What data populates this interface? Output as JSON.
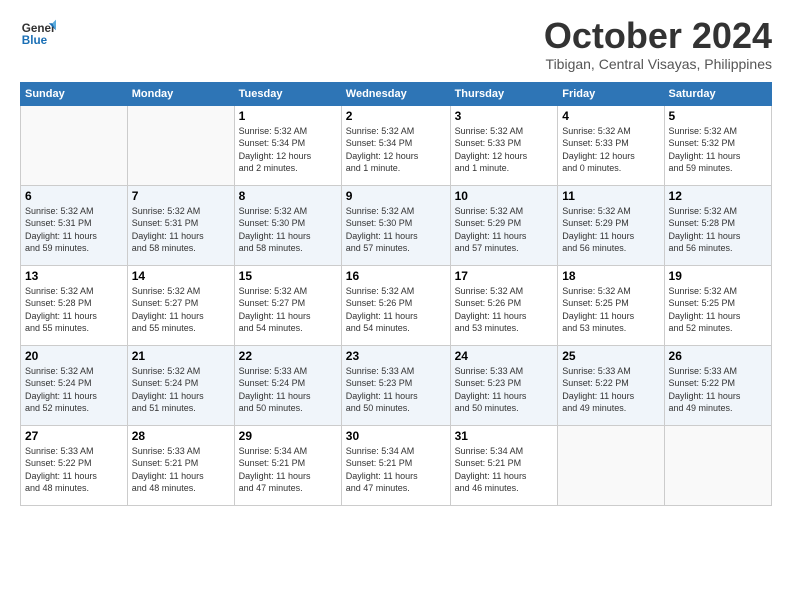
{
  "header": {
    "logo_line1": "General",
    "logo_line2": "Blue",
    "month": "October 2024",
    "location": "Tibigan, Central Visayas, Philippines"
  },
  "columns": [
    "Sunday",
    "Monday",
    "Tuesday",
    "Wednesday",
    "Thursday",
    "Friday",
    "Saturday"
  ],
  "rows": [
    [
      {
        "num": "",
        "info": ""
      },
      {
        "num": "",
        "info": ""
      },
      {
        "num": "1",
        "info": "Sunrise: 5:32 AM\nSunset: 5:34 PM\nDaylight: 12 hours\nand 2 minutes."
      },
      {
        "num": "2",
        "info": "Sunrise: 5:32 AM\nSunset: 5:34 PM\nDaylight: 12 hours\nand 1 minute."
      },
      {
        "num": "3",
        "info": "Sunrise: 5:32 AM\nSunset: 5:33 PM\nDaylight: 12 hours\nand 1 minute."
      },
      {
        "num": "4",
        "info": "Sunrise: 5:32 AM\nSunset: 5:33 PM\nDaylight: 12 hours\nand 0 minutes."
      },
      {
        "num": "5",
        "info": "Sunrise: 5:32 AM\nSunset: 5:32 PM\nDaylight: 11 hours\nand 59 minutes."
      }
    ],
    [
      {
        "num": "6",
        "info": "Sunrise: 5:32 AM\nSunset: 5:31 PM\nDaylight: 11 hours\nand 59 minutes."
      },
      {
        "num": "7",
        "info": "Sunrise: 5:32 AM\nSunset: 5:31 PM\nDaylight: 11 hours\nand 58 minutes."
      },
      {
        "num": "8",
        "info": "Sunrise: 5:32 AM\nSunset: 5:30 PM\nDaylight: 11 hours\nand 58 minutes."
      },
      {
        "num": "9",
        "info": "Sunrise: 5:32 AM\nSunset: 5:30 PM\nDaylight: 11 hours\nand 57 minutes."
      },
      {
        "num": "10",
        "info": "Sunrise: 5:32 AM\nSunset: 5:29 PM\nDaylight: 11 hours\nand 57 minutes."
      },
      {
        "num": "11",
        "info": "Sunrise: 5:32 AM\nSunset: 5:29 PM\nDaylight: 11 hours\nand 56 minutes."
      },
      {
        "num": "12",
        "info": "Sunrise: 5:32 AM\nSunset: 5:28 PM\nDaylight: 11 hours\nand 56 minutes."
      }
    ],
    [
      {
        "num": "13",
        "info": "Sunrise: 5:32 AM\nSunset: 5:28 PM\nDaylight: 11 hours\nand 55 minutes."
      },
      {
        "num": "14",
        "info": "Sunrise: 5:32 AM\nSunset: 5:27 PM\nDaylight: 11 hours\nand 55 minutes."
      },
      {
        "num": "15",
        "info": "Sunrise: 5:32 AM\nSunset: 5:27 PM\nDaylight: 11 hours\nand 54 minutes."
      },
      {
        "num": "16",
        "info": "Sunrise: 5:32 AM\nSunset: 5:26 PM\nDaylight: 11 hours\nand 54 minutes."
      },
      {
        "num": "17",
        "info": "Sunrise: 5:32 AM\nSunset: 5:26 PM\nDaylight: 11 hours\nand 53 minutes."
      },
      {
        "num": "18",
        "info": "Sunrise: 5:32 AM\nSunset: 5:25 PM\nDaylight: 11 hours\nand 53 minutes."
      },
      {
        "num": "19",
        "info": "Sunrise: 5:32 AM\nSunset: 5:25 PM\nDaylight: 11 hours\nand 52 minutes."
      }
    ],
    [
      {
        "num": "20",
        "info": "Sunrise: 5:32 AM\nSunset: 5:24 PM\nDaylight: 11 hours\nand 52 minutes."
      },
      {
        "num": "21",
        "info": "Sunrise: 5:32 AM\nSunset: 5:24 PM\nDaylight: 11 hours\nand 51 minutes."
      },
      {
        "num": "22",
        "info": "Sunrise: 5:33 AM\nSunset: 5:24 PM\nDaylight: 11 hours\nand 50 minutes."
      },
      {
        "num": "23",
        "info": "Sunrise: 5:33 AM\nSunset: 5:23 PM\nDaylight: 11 hours\nand 50 minutes."
      },
      {
        "num": "24",
        "info": "Sunrise: 5:33 AM\nSunset: 5:23 PM\nDaylight: 11 hours\nand 50 minutes."
      },
      {
        "num": "25",
        "info": "Sunrise: 5:33 AM\nSunset: 5:22 PM\nDaylight: 11 hours\nand 49 minutes."
      },
      {
        "num": "26",
        "info": "Sunrise: 5:33 AM\nSunset: 5:22 PM\nDaylight: 11 hours\nand 49 minutes."
      }
    ],
    [
      {
        "num": "27",
        "info": "Sunrise: 5:33 AM\nSunset: 5:22 PM\nDaylight: 11 hours\nand 48 minutes."
      },
      {
        "num": "28",
        "info": "Sunrise: 5:33 AM\nSunset: 5:21 PM\nDaylight: 11 hours\nand 48 minutes."
      },
      {
        "num": "29",
        "info": "Sunrise: 5:34 AM\nSunset: 5:21 PM\nDaylight: 11 hours\nand 47 minutes."
      },
      {
        "num": "30",
        "info": "Sunrise: 5:34 AM\nSunset: 5:21 PM\nDaylight: 11 hours\nand 47 minutes."
      },
      {
        "num": "31",
        "info": "Sunrise: 5:34 AM\nSunset: 5:21 PM\nDaylight: 11 hours\nand 46 minutes."
      },
      {
        "num": "",
        "info": ""
      },
      {
        "num": "",
        "info": ""
      }
    ]
  ]
}
